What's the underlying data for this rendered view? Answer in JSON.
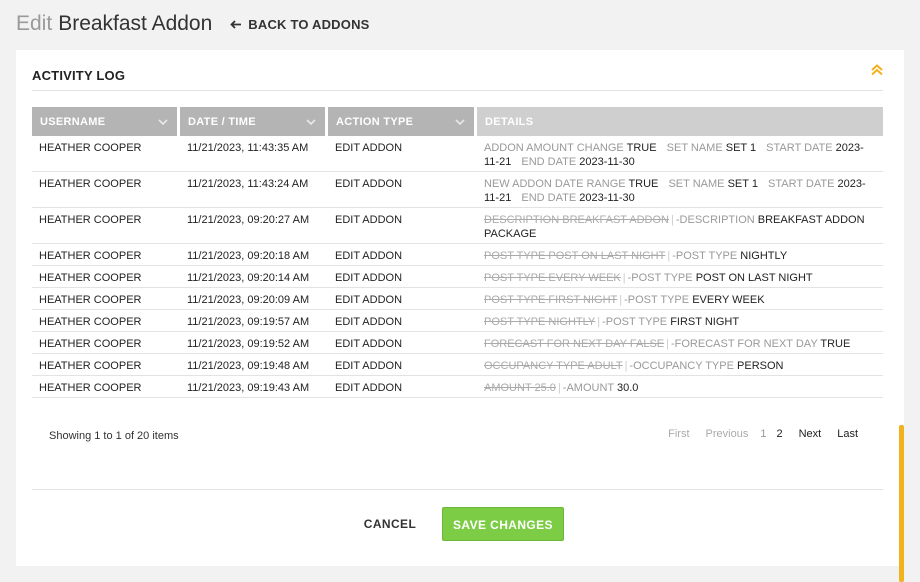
{
  "header": {
    "title_prefix": "Edit",
    "title_name": "Breakfast Addon",
    "back_label": "BACK TO ADDONS"
  },
  "activity_log": {
    "heading": "ACTIVITY LOG",
    "columns": [
      "USERNAME",
      "DATE / TIME",
      "ACTION TYPE",
      "DETAILS"
    ],
    "rows": [
      {
        "user": "HEATHER COOPER",
        "datetime": "11/21/2023, 11:43:35 AM",
        "action": "EDIT ADDON",
        "d": {
          "k1": "ADDON AMOUNT CHANGE",
          "v1": "TRUE",
          "k2": "SET NAME",
          "v2": "SET 1",
          "k3": "START DATE",
          "v3": "2023-11-21",
          "k4": "END DATE",
          "v4": "2023-11-30"
        }
      },
      {
        "user": "HEATHER COOPER",
        "datetime": "11/21/2023, 11:43:24 AM",
        "action": "EDIT ADDON",
        "d": {
          "k1": "NEW ADDON DATE RANGE",
          "v1": "TRUE",
          "k2": "SET NAME",
          "v2": "SET 1",
          "k3": "START DATE",
          "v3": "2023-11-21",
          "k4": "END DATE",
          "v4": "2023-11-30"
        }
      },
      {
        "user": "HEATHER COOPER",
        "datetime": "11/21/2023, 09:20:27 AM",
        "action": "EDIT ADDON",
        "d": {
          "old": "DESCRIPTION BREAKFAST ADDON",
          "key": "-DESCRIPTION",
          "val": "BREAKFAST ADDON PACKAGE"
        }
      },
      {
        "user": "HEATHER COOPER",
        "datetime": "11/21/2023, 09:20:18 AM",
        "action": "EDIT ADDON",
        "d": {
          "old": "POST TYPE POST ON LAST NIGHT",
          "key": "-POST TYPE",
          "val": "NIGHTLY"
        }
      },
      {
        "user": "HEATHER COOPER",
        "datetime": "11/21/2023, 09:20:14 AM",
        "action": "EDIT ADDON",
        "d": {
          "old": "POST TYPE EVERY WEEK",
          "key": "-POST TYPE",
          "val": "POST ON LAST NIGHT"
        }
      },
      {
        "user": "HEATHER COOPER",
        "datetime": "11/21/2023, 09:20:09 AM",
        "action": "EDIT ADDON",
        "d": {
          "old": "POST TYPE FIRST NIGHT",
          "key": "-POST TYPE",
          "val": "EVERY WEEK"
        }
      },
      {
        "user": "HEATHER COOPER",
        "datetime": "11/21/2023, 09:19:57 AM",
        "action": "EDIT ADDON",
        "d": {
          "old": "POST TYPE NIGHTLY",
          "key": "-POST TYPE",
          "val": "FIRST NIGHT"
        }
      },
      {
        "user": "HEATHER COOPER",
        "datetime": "11/21/2023, 09:19:52 AM",
        "action": "EDIT ADDON",
        "d": {
          "old": "FORECAST FOR NEXT DAY FALSE",
          "key": "-FORECAST FOR NEXT DAY",
          "val": "TRUE"
        }
      },
      {
        "user": "HEATHER COOPER",
        "datetime": "11/21/2023, 09:19:48 AM",
        "action": "EDIT ADDON",
        "d": {
          "old": "OCCUPANCY TYPE ADULT",
          "key": "-OCCUPANCY TYPE",
          "val": "PERSON"
        }
      },
      {
        "user": "HEATHER COOPER",
        "datetime": "11/21/2023, 09:19:43 AM",
        "action": "EDIT ADDON",
        "d": {
          "old": "AMOUNT 25.0",
          "key": "-AMOUNT",
          "val": "30.0"
        }
      }
    ],
    "showing": "Showing 1 to 1 of 20 items",
    "pager": {
      "first": "First",
      "previous": "Previous",
      "page1": "1",
      "page2": "2",
      "next": "Next",
      "last": "Last"
    }
  },
  "footer": {
    "cancel_label": "CANCEL",
    "save_label": "SAVE CHANGES"
  },
  "colors": {
    "header_cell": "#b4b4b4",
    "details_header": "#cfcfcf",
    "save_green": "#7ccd45",
    "accent_orange": "#f1b21f"
  }
}
